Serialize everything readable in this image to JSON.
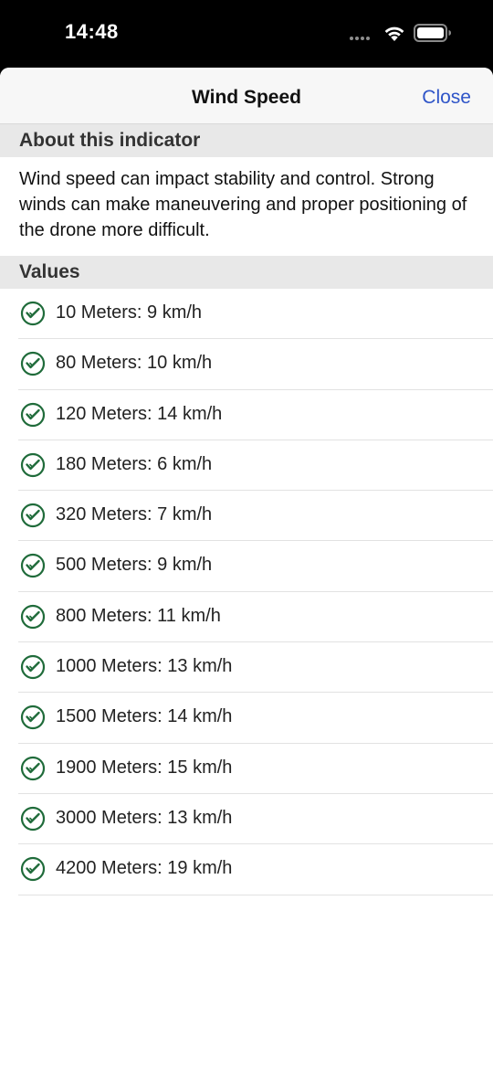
{
  "status_bar": {
    "time": "14:48",
    "icons": [
      "signal-dots-icon",
      "wifi-icon",
      "battery-icon"
    ]
  },
  "nav": {
    "title": "Wind Speed",
    "close_label": "Close"
  },
  "about": {
    "header": "About this indicator",
    "text": "Wind speed can impact stability and control. Strong winds can make maneuvering and proper positioning of the drone more difficult."
  },
  "values": {
    "header": "Values",
    "items": [
      {
        "label": "10 Meters: 9 km/h",
        "icon": "check-circle-icon"
      },
      {
        "label": "80 Meters: 10 km/h",
        "icon": "check-circle-icon"
      },
      {
        "label": "120 Meters: 14 km/h",
        "icon": "check-circle-icon"
      },
      {
        "label": "180 Meters: 6 km/h",
        "icon": "check-circle-icon"
      },
      {
        "label": "320 Meters: 7 km/h",
        "icon": "check-circle-icon"
      },
      {
        "label": "500 Meters: 9 km/h",
        "icon": "check-circle-icon"
      },
      {
        "label": "800 Meters: 11 km/h",
        "icon": "check-circle-icon"
      },
      {
        "label": "1000 Meters: 13 km/h",
        "icon": "check-circle-icon"
      },
      {
        "label": "1500 Meters: 14 km/h",
        "icon": "check-circle-icon"
      },
      {
        "label": "1900 Meters: 15 km/h",
        "icon": "check-circle-icon"
      },
      {
        "label": "3000 Meters: 13 km/h",
        "icon": "check-circle-icon"
      },
      {
        "label": "4200 Meters: 19 km/h",
        "icon": "check-circle-icon"
      }
    ]
  },
  "colors": {
    "accent": "#2f55c8",
    "check": "#1f6b3a",
    "section_bg": "#e8e8e8"
  }
}
